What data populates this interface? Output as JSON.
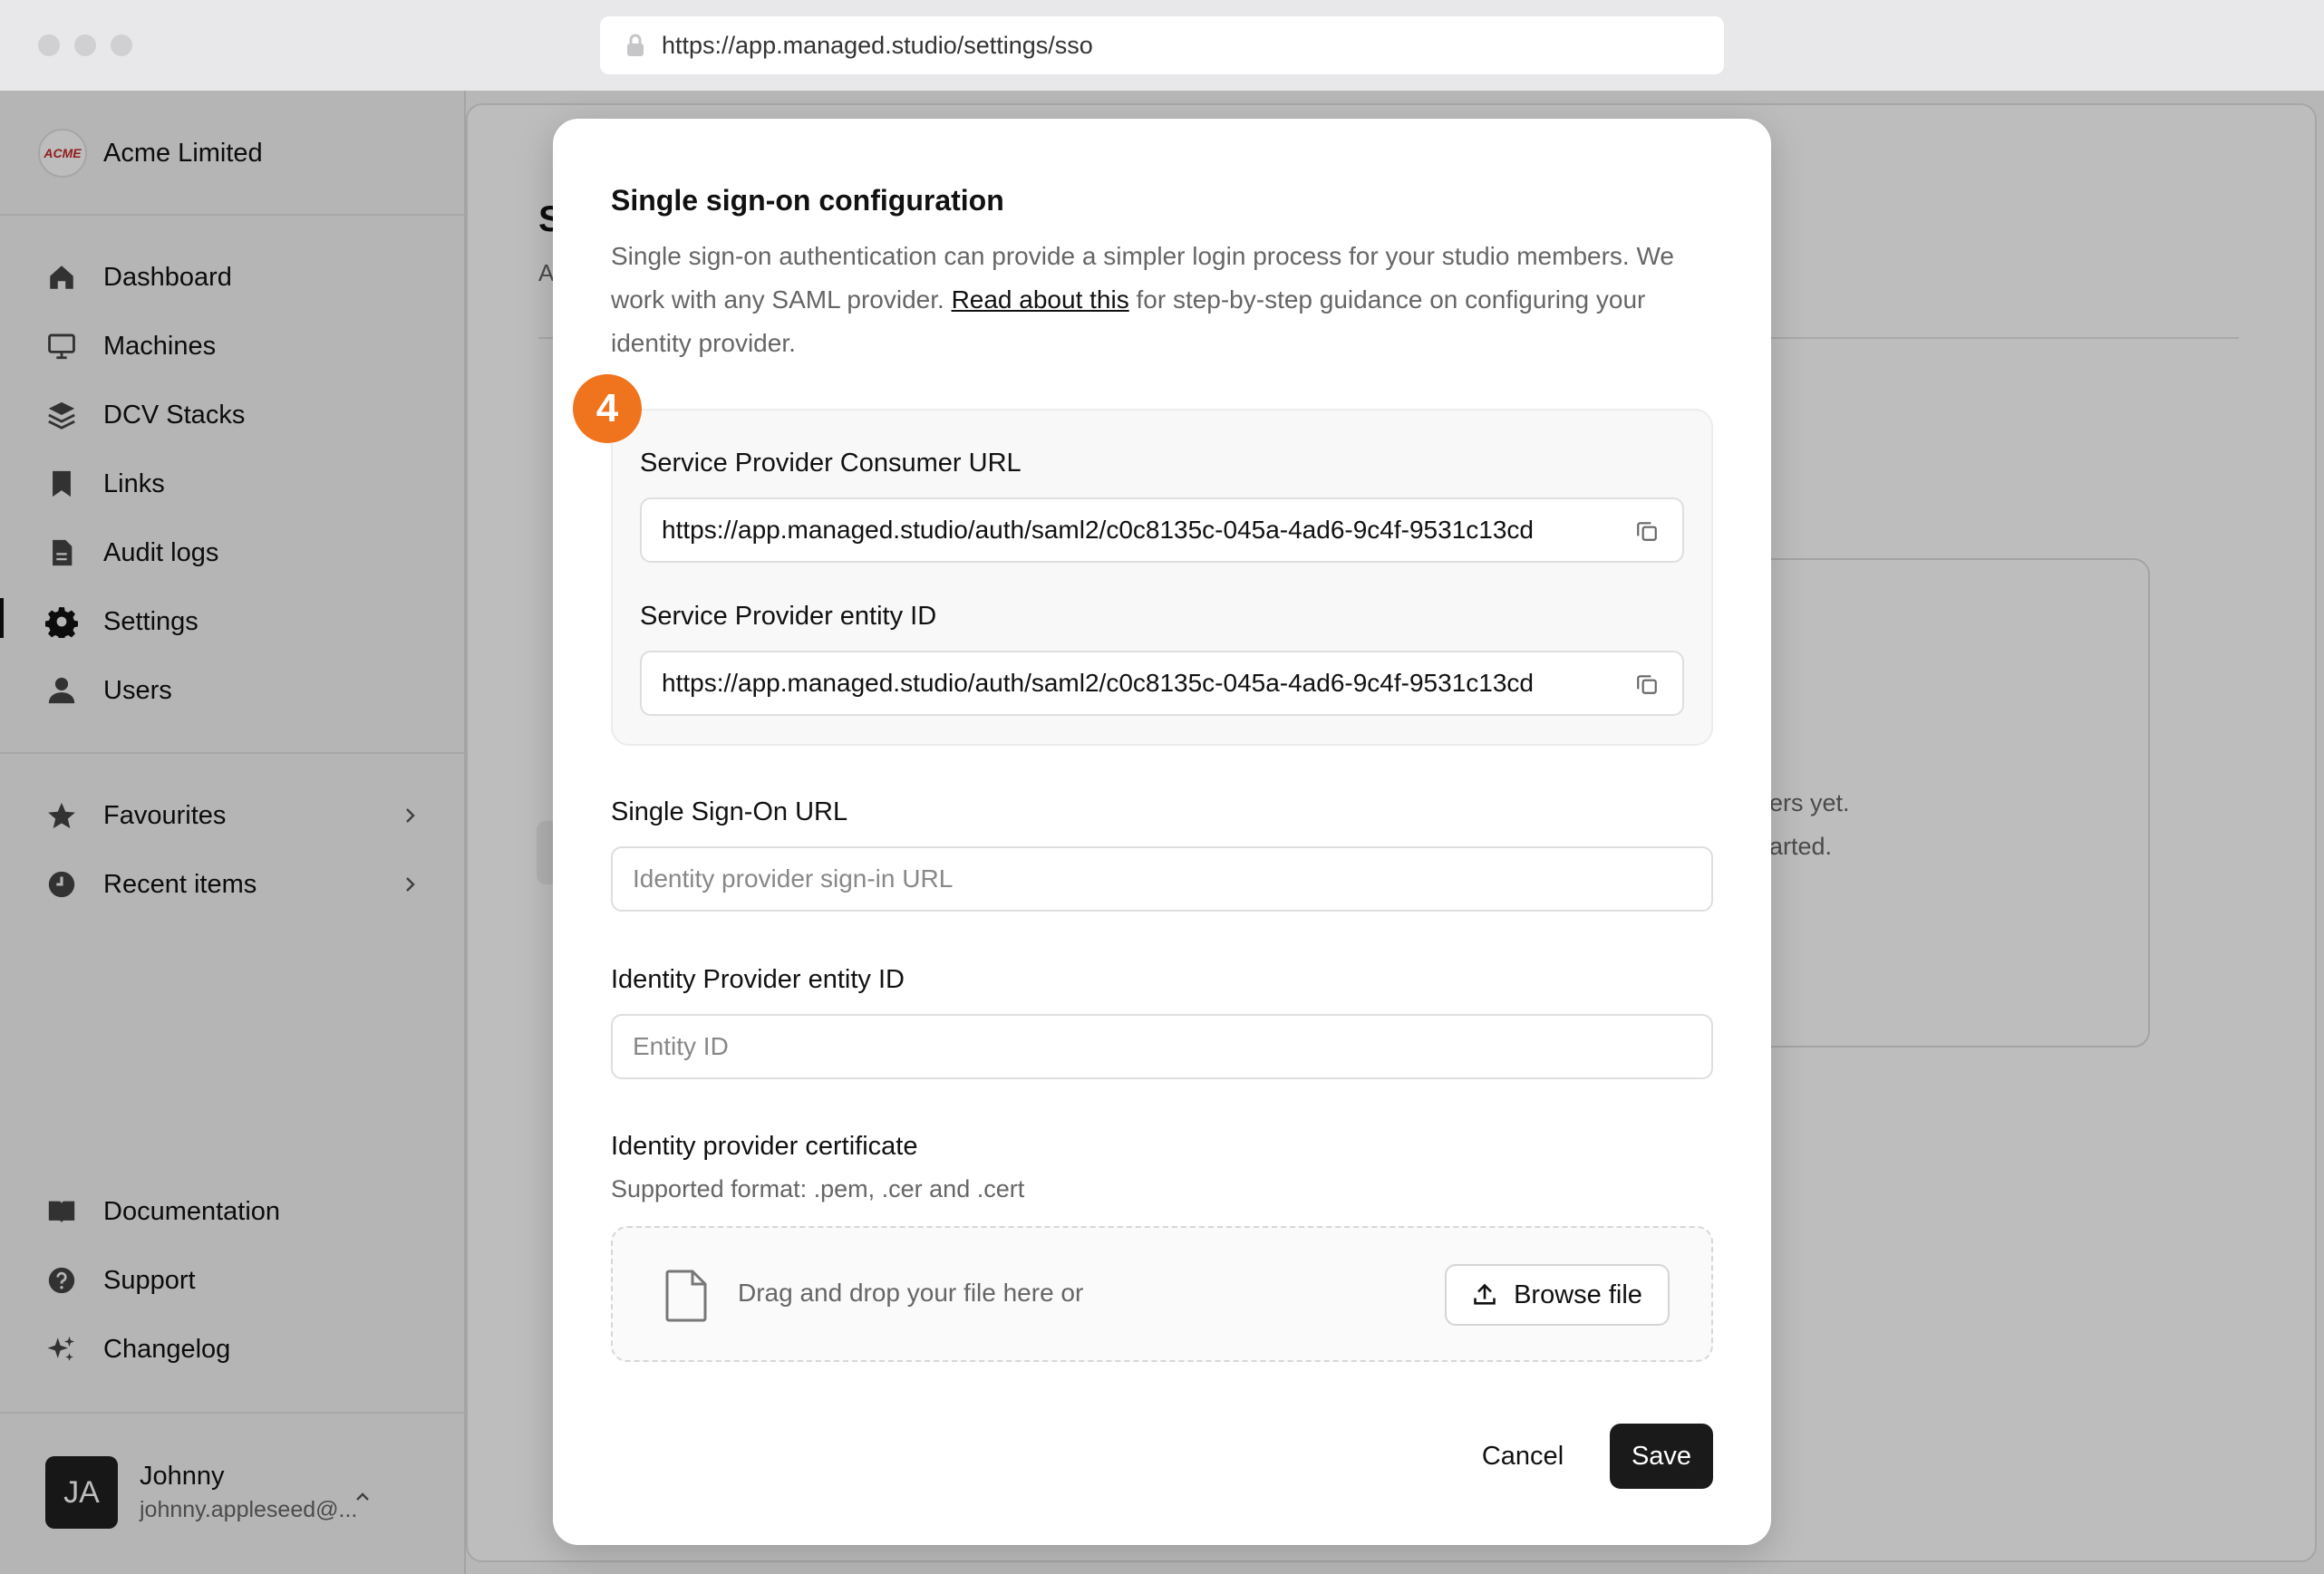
{
  "browser": {
    "url": "https://app.managed.studio/settings/sso"
  },
  "sidebar": {
    "org_logo": "ACME",
    "org_name": "Acme Limited",
    "nav": [
      {
        "label": "Dashboard",
        "icon": "home-icon"
      },
      {
        "label": "Machines",
        "icon": "monitor-icon"
      },
      {
        "label": "DCV Stacks",
        "icon": "layers-icon"
      },
      {
        "label": "Links",
        "icon": "bookmark-icon"
      },
      {
        "label": "Audit logs",
        "icon": "document-icon"
      },
      {
        "label": "Settings",
        "icon": "gear-icon",
        "active": true
      },
      {
        "label": "Users",
        "icon": "user-icon"
      }
    ],
    "secondary": [
      {
        "label": "Favourites",
        "icon": "star-icon"
      },
      {
        "label": "Recent items",
        "icon": "clock-icon"
      }
    ],
    "footer": [
      {
        "label": "Documentation",
        "icon": "book-icon"
      },
      {
        "label": "Support",
        "icon": "help-icon"
      },
      {
        "label": "Changelog",
        "icon": "sparkles-icon"
      }
    ],
    "user": {
      "initials": "JA",
      "name": "Johnny",
      "email": "johnny.appleseed@..."
    }
  },
  "background": {
    "title_fragment": "S",
    "subtitle_fragment": "A",
    "empty_line1": "ers yet.",
    "empty_line2": "arted."
  },
  "modal": {
    "title": "Single sign-on configuration",
    "desc_before": "Single sign-on authentication can provide a simpler login process for your studio members. We work with any SAML provider. ",
    "desc_link": "Read about this",
    "desc_after": " for step-by-step guidance on configuring your identity provider.",
    "step_badge": "4",
    "sp_consumer_label": "Service Provider Consumer URL",
    "sp_consumer_value": "https://app.managed.studio/auth/saml2/c0c8135c-045a-4ad6-9c4f-9531c13cd",
    "sp_entity_label": "Service Provider entity ID",
    "sp_entity_value": "https://app.managed.studio/auth/saml2/c0c8135c-045a-4ad6-9c4f-9531c13cd",
    "sso_url_label": "Single Sign-On URL",
    "sso_url_placeholder": "Identity provider sign-in URL",
    "idp_entity_label": "Identity Provider entity ID",
    "idp_entity_placeholder": "Entity ID",
    "cert_label": "Identity provider certificate",
    "cert_hint": "Supported format: .pem, .cer and .cert",
    "drop_text": "Drag and drop your file here or",
    "browse_label": "Browse file",
    "cancel_label": "Cancel",
    "save_label": "Save"
  },
  "colors": {
    "badge": "#f0731d",
    "primary_button": "#1a1a1a"
  }
}
